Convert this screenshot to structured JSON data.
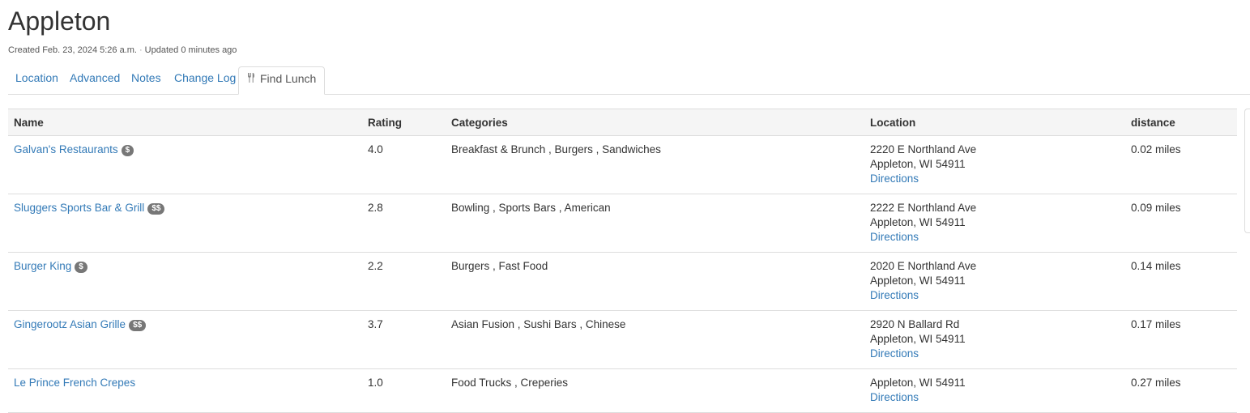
{
  "header": {
    "title": "Appleton",
    "created": "Created Feb. 23, 2024 5:26 a.m.",
    "separator": "·",
    "updated": "Updated 0 minutes ago"
  },
  "tabs": [
    {
      "label": "Location"
    },
    {
      "label": "Advanced"
    },
    {
      "label": "Notes"
    },
    {
      "label": "Change Log"
    },
    {
      "label": "Find Lunch",
      "icon": "utensils-icon",
      "active": true
    }
  ],
  "table": {
    "columns": [
      "Name",
      "Rating",
      "Categories",
      "Location",
      "distance"
    ],
    "rows": [
      {
        "name": "Galvan's Restaurants",
        "price": "$",
        "rating": "4.0",
        "categories": "Breakfast & Brunch , Burgers , Sandwiches",
        "address1": "2220 E Northland Ave",
        "address2": "Appleton, WI 54911",
        "directions": "Directions",
        "distance": "0.02 miles"
      },
      {
        "name": "Sluggers Sports Bar & Grill",
        "price": "$$",
        "rating": "2.8",
        "categories": "Bowling , Sports Bars , American",
        "address1": "2222 E Northland Ave",
        "address2": "Appleton, WI 54911",
        "directions": "Directions",
        "distance": "0.09 miles"
      },
      {
        "name": "Burger King",
        "price": "$",
        "rating": "2.2",
        "categories": "Burgers , Fast Food",
        "address1": "2020 E Northland Ave",
        "address2": "Appleton, WI 54911",
        "directions": "Directions",
        "distance": "0.14 miles"
      },
      {
        "name": "Gingerootz Asian Grille",
        "price": "$$",
        "rating": "3.7",
        "categories": "Asian Fusion , Sushi Bars , Chinese",
        "address1": "2920 N Ballard Rd",
        "address2": "Appleton, WI 54911",
        "directions": "Directions",
        "distance": "0.17 miles"
      },
      {
        "name": "Le Prince French Crepes",
        "price": "",
        "rating": "1.0",
        "categories": "Food Trucks , Creperies",
        "address1": "",
        "address2": "Appleton, WI 54911",
        "directions": "Directions",
        "distance": "0.27 miles"
      }
    ]
  },
  "colors": {
    "link": "#337ab7",
    "badge": "#777777",
    "header_bg": "#f5f5f5",
    "border": "#dddddd"
  }
}
